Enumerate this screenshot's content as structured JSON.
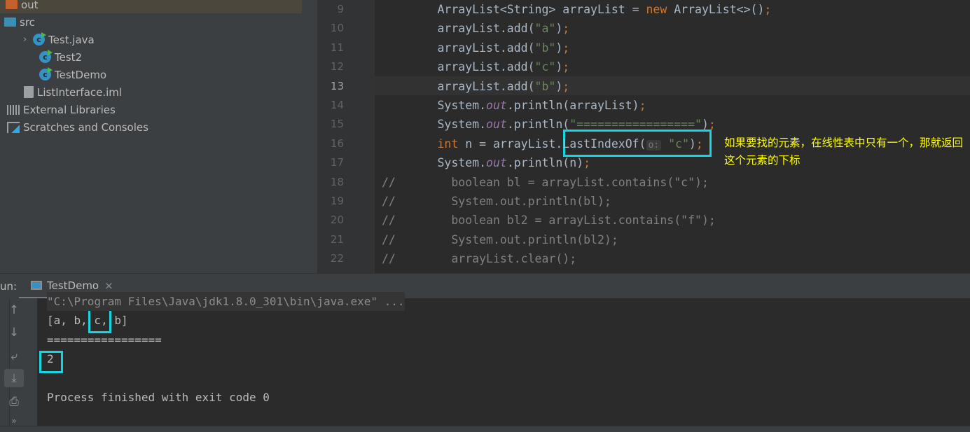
{
  "project_tree": [
    {
      "label": "out",
      "icon": "folder-orange-icon",
      "chevron": "›",
      "selected": true
    },
    {
      "label": "src",
      "icon": "folder-blue-icon",
      "chevron": "⌄"
    },
    {
      "label": "Test.java",
      "icon": "java-class-icon",
      "chevron": "›"
    },
    {
      "label": "Test2",
      "icon": "java-class-icon"
    },
    {
      "label": "TestDemo",
      "icon": "java-class-icon"
    },
    {
      "label": "ListInterface.iml",
      "icon": "iml-file-icon"
    },
    {
      "label": "External Libraries",
      "icon": "libraries-icon"
    },
    {
      "label": "Scratches and Consoles",
      "icon": "scratches-icon"
    }
  ],
  "editor": {
    "current_line": "13",
    "lines": [
      {
        "n": "9",
        "t": [
          [
            "",
            "        ArrayList<String> arrayList = "
          ],
          [
            "kw",
            "new"
          ],
          [
            "",
            " ArrayList<>()"
          ],
          [
            "kw",
            ";"
          ]
        ]
      },
      {
        "n": "10",
        "t": [
          [
            "",
            "        arrayList.add("
          ],
          [
            "str",
            "\"a\""
          ],
          [
            "",
            ")"
          ],
          [
            "kw",
            ";"
          ]
        ]
      },
      {
        "n": "11",
        "t": [
          [
            "",
            "        arrayList.add("
          ],
          [
            "str",
            "\"b\""
          ],
          [
            "",
            ")"
          ],
          [
            "kw",
            ";"
          ]
        ]
      },
      {
        "n": "12",
        "t": [
          [
            "",
            "        arrayList.add("
          ],
          [
            "str",
            "\"c\""
          ],
          [
            "",
            ")"
          ],
          [
            "kw",
            ";"
          ]
        ]
      },
      {
        "n": "13",
        "t": [
          [
            "",
            "        arrayList.add("
          ],
          [
            "str",
            "\"b\""
          ],
          [
            "",
            ")"
          ],
          [
            "kw",
            ";"
          ]
        ]
      },
      {
        "n": "14",
        "t": [
          [
            "",
            "        System."
          ],
          [
            "fld",
            "out"
          ],
          [
            "",
            ".println(arrayList)"
          ],
          [
            "kw",
            ";"
          ]
        ]
      },
      {
        "n": "15",
        "t": [
          [
            "",
            "        System."
          ],
          [
            "fld",
            "out"
          ],
          [
            "",
            ".println("
          ],
          [
            "str",
            "\"=================\""
          ],
          [
            "",
            ")"
          ],
          [
            "kw",
            ";"
          ]
        ]
      },
      {
        "n": "16",
        "t": [
          [
            "kw",
            "        int"
          ],
          [
            "",
            " n = arrayList.LastIndexOf("
          ],
          [
            "hint",
            "o:"
          ],
          [
            "str",
            " \"c\""
          ],
          [
            "",
            ")"
          ],
          [
            "kw",
            ";"
          ]
        ]
      },
      {
        "n": "17",
        "t": [
          [
            "",
            "        System."
          ],
          [
            "fld",
            "out"
          ],
          [
            "",
            ".println(n)"
          ],
          [
            "kw",
            ";"
          ]
        ]
      },
      {
        "n": "18",
        "t": [
          [
            "cm",
            "//        boolean bl = arrayList.contains(\"c\");"
          ]
        ]
      },
      {
        "n": "19",
        "t": [
          [
            "cm",
            "//        System.out.println(bl);"
          ]
        ]
      },
      {
        "n": "20",
        "t": [
          [
            "cm",
            "//        boolean bl2 = arrayList.contains(\"f\");"
          ]
        ]
      },
      {
        "n": "21",
        "t": [
          [
            "cm",
            "//        System.out.println(bl2);"
          ]
        ]
      },
      {
        "n": "22",
        "t": [
          [
            "cm",
            "//        arrayList.clear();"
          ]
        ]
      }
    ]
  },
  "annotation": "如果要找的元素，在线性表中只有一个，那就返回这个元素的下标",
  "highlight_color": "#13d6e0",
  "run": {
    "label": "un:",
    "tab": "TestDemo",
    "close": "×",
    "output": [
      "\"C:\\Program Files\\Java\\jdk1.8.0_301\\bin\\java.exe\" ...",
      "[a, b, c, b]",
      "=================",
      "2",
      "",
      "Process finished with exit code 0"
    ],
    "tools": [
      {
        "name": "up-arrow-icon",
        "glyph": "↑"
      },
      {
        "name": "down-arrow-icon",
        "glyph": "↓"
      },
      {
        "name": "soft-wrap-icon",
        "glyph": "⤶"
      },
      {
        "name": "scroll-to-end-icon",
        "glyph": "⤓"
      },
      {
        "name": "print-icon",
        "glyph": "⎙"
      },
      {
        "name": "more-icon",
        "glyph": "»"
      }
    ]
  }
}
